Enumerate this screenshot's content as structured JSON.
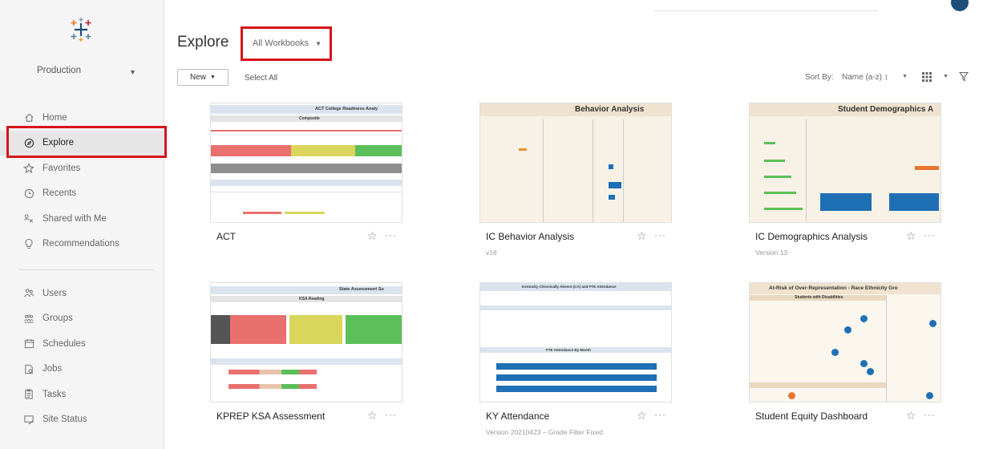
{
  "sidebar": {
    "site_name": "Production",
    "nav_top": [
      {
        "label": "Home",
        "icon": "home-icon"
      },
      {
        "label": "Explore",
        "icon": "compass-icon",
        "active": true
      },
      {
        "label": "Favorites",
        "icon": "star-icon"
      },
      {
        "label": "Recents",
        "icon": "clock-icon"
      },
      {
        "label": "Shared with Me",
        "icon": "share-icon"
      },
      {
        "label": "Recommendations",
        "icon": "lightbulb-icon"
      }
    ],
    "nav_admin": [
      {
        "label": "Users",
        "icon": "users-icon"
      },
      {
        "label": "Groups",
        "icon": "groups-icon"
      },
      {
        "label": "Schedules",
        "icon": "calendar-icon"
      },
      {
        "label": "Jobs",
        "icon": "jobs-icon"
      },
      {
        "label": "Tasks",
        "icon": "tasks-icon"
      },
      {
        "label": "Site Status",
        "icon": "site-status-icon"
      }
    ]
  },
  "header": {
    "title": "Explore",
    "content_type": "All Workbooks"
  },
  "toolbar": {
    "new_label": "New",
    "select_all_label": "Select All",
    "sort_label": "Sort By:",
    "sort_value": "Name (a-z) ↕"
  },
  "colors": {
    "highlight_red": "#d4151b",
    "tableau_blue": "#1f6fb5",
    "bar_red": "#e8706d",
    "bar_yellow": "#d9d55d",
    "bar_green": "#5bbf5a"
  },
  "workbooks": [
    {
      "name": "ACT",
      "subtitle": "",
      "thumb_title": "ACT College Readiness Analy",
      "thumb_sub": "Composite"
    },
    {
      "name": "IC Behavior Analysis",
      "subtitle": "v18",
      "thumb_title": "Behavior Analysis",
      "thumb_sub": ""
    },
    {
      "name": "IC Demographics Analysis",
      "subtitle": "Version 13",
      "thumb_title": "Student Demographics A",
      "thumb_sub": ""
    },
    {
      "name": "KPREP KSA Assessment",
      "subtitle": "",
      "thumb_title": "State Assessment Su",
      "thumb_sub": "KSA Reading"
    },
    {
      "name": "KY Attendance",
      "subtitle": "Version 20210423 – Grade Filter Fixed",
      "thumb_title": "Kentucky Chronically Absent (CA) and FTE Attendance",
      "thumb_sub": "FTE Attendance By Month"
    },
    {
      "name": "Student Equity Dashboard",
      "subtitle": "",
      "thumb_title": "At-Risk of Over-Representation - Race Ethnicity Gro",
      "thumb_sub": "Students with Disabilities"
    }
  ]
}
